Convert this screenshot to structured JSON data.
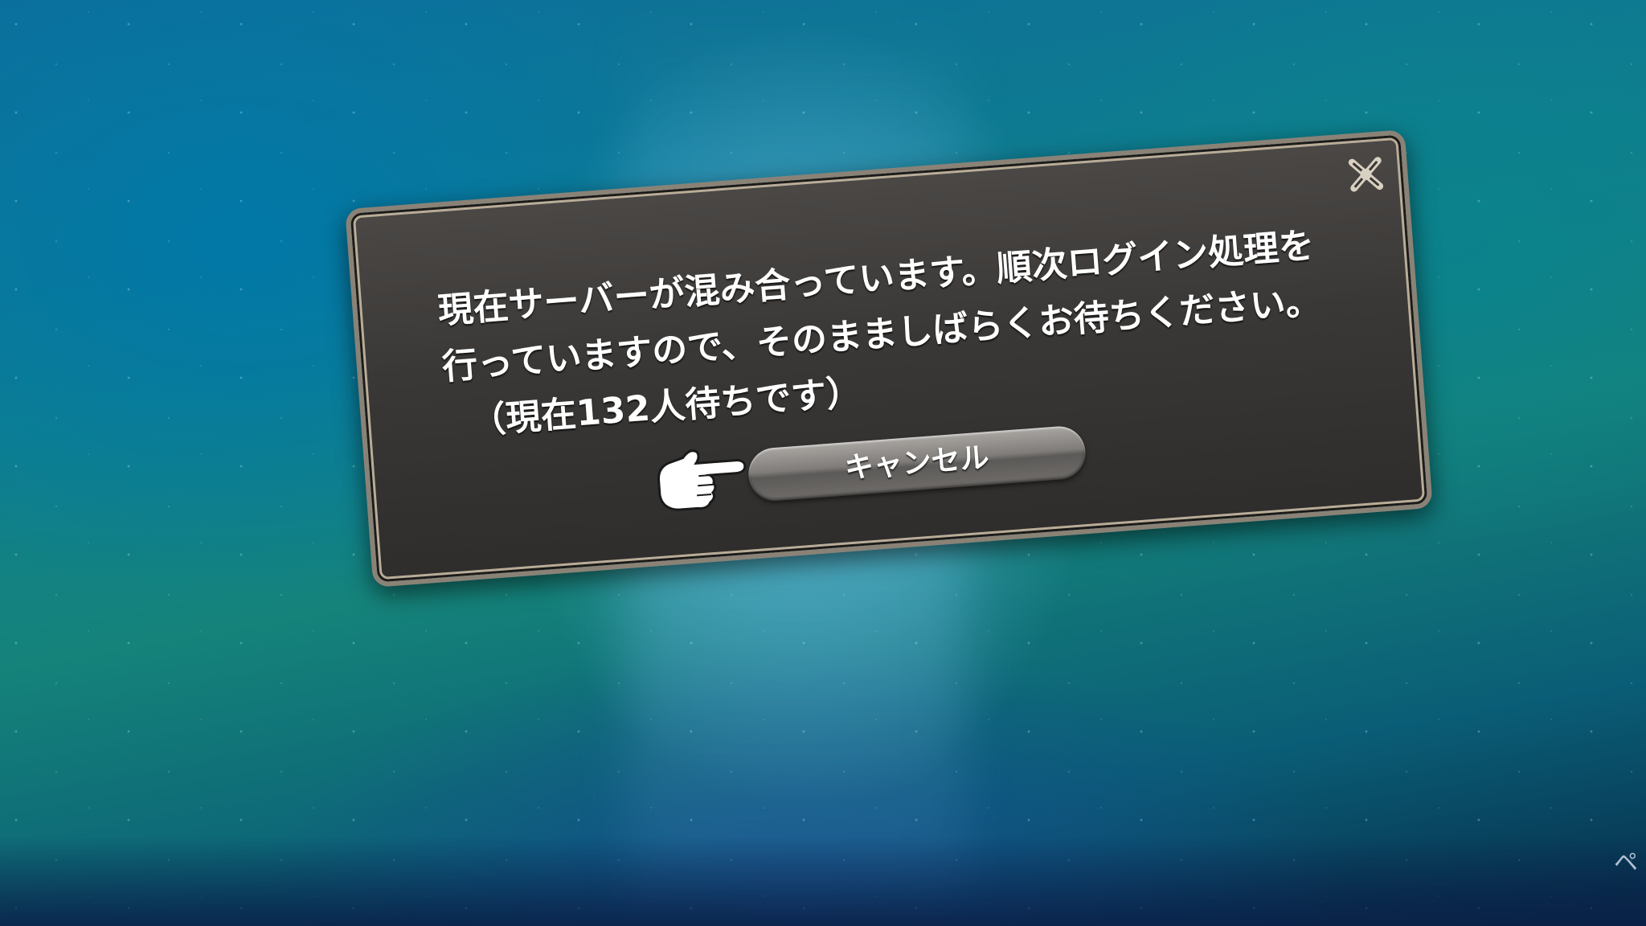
{
  "dialog": {
    "message_lines": [
      "現在サーバーが混み合っています。順次ログイン処理を",
      "行っていますので、そのまましばらくお待ちください。",
      "（現在132人待ちです）"
    ],
    "cancel_label": "キャンセル",
    "close_icon": "close-icon",
    "pointer_icon": "hand-pointer-icon"
  },
  "corner": {
    "text": "ペ"
  },
  "colors": {
    "dialog_bg": "#3a3836",
    "dialog_border": "#b9ad98",
    "button_bg": "#7f7c79",
    "text": "#ffffff",
    "background": "#0f7f8e"
  }
}
